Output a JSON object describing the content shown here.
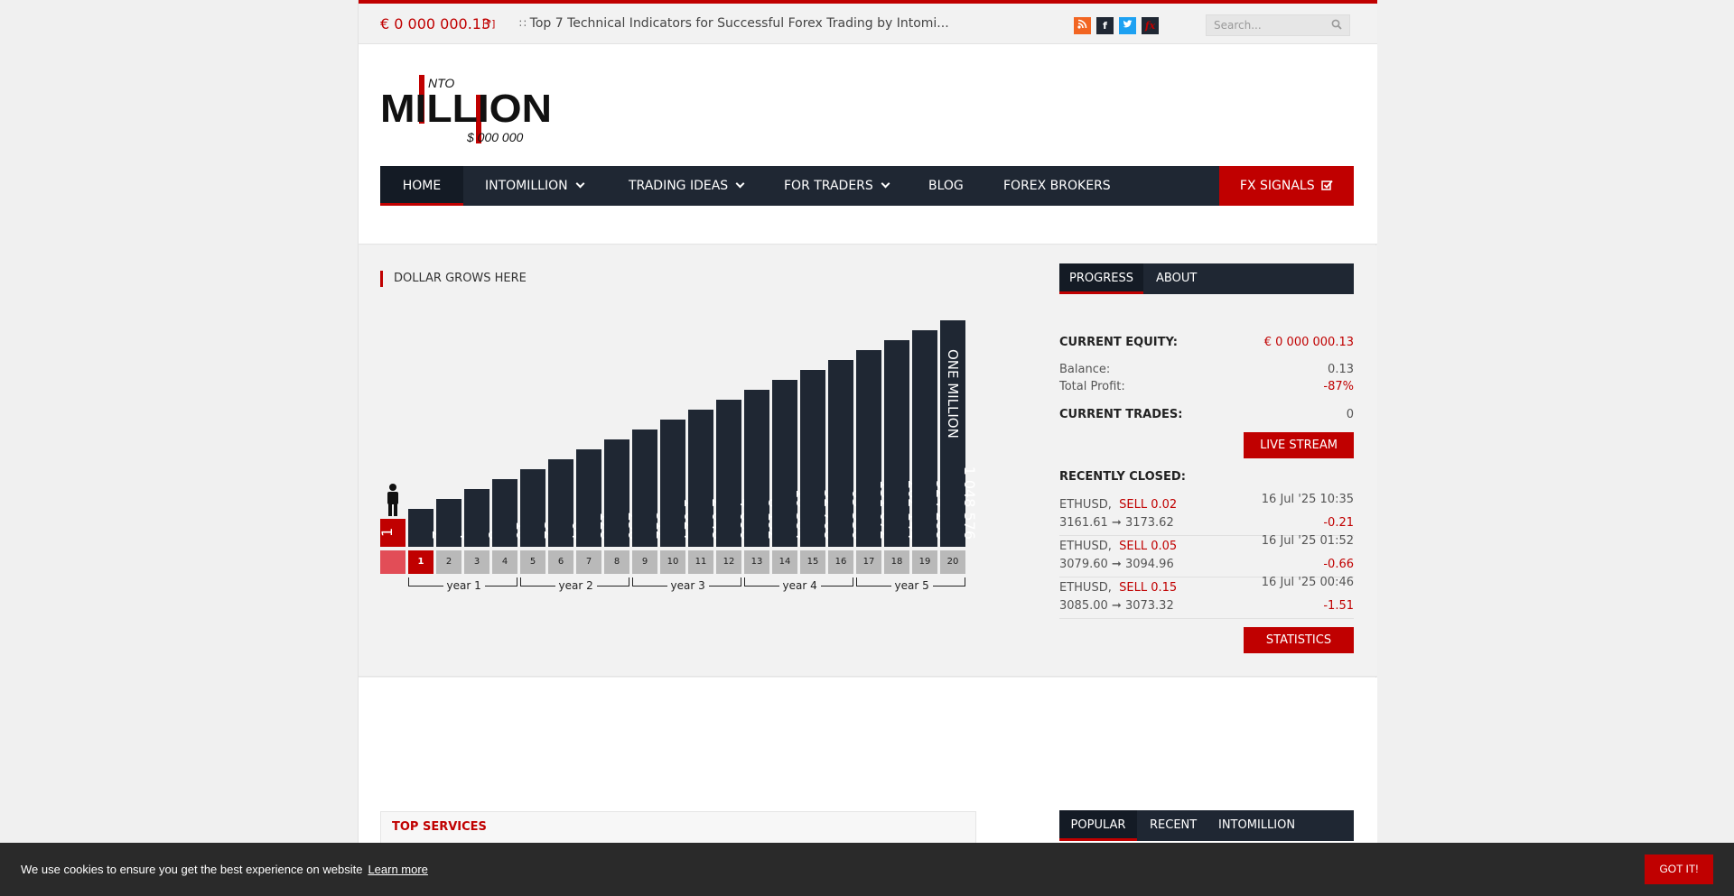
{
  "topbar": {
    "equity": "€ 0 000 000.13",
    "equity_help": "[?]",
    "news_text": "Top 7 Technical Indicators for Successful Forex Trading by Intomi...",
    "search_placeholder": "Search...",
    "social_icons": [
      "rss-icon",
      "facebook-icon",
      "twitter-icon",
      "fx-icon"
    ]
  },
  "logo": {
    "small_text": "NTO",
    "main_text": "MILLION",
    "sub_text": "$ 000 000"
  },
  "nav": {
    "items": [
      {
        "label": "HOME",
        "dropdown": false,
        "active": true
      },
      {
        "label": "INTOMILLION",
        "dropdown": true,
        "active": false
      },
      {
        "label": "TRADING IDEAS",
        "dropdown": true,
        "active": false
      },
      {
        "label": "FOR TRADERS",
        "dropdown": true,
        "active": false
      },
      {
        "label": "BLOG",
        "dropdown": false,
        "active": false
      },
      {
        "label": "FOREX BROKERS",
        "dropdown": false,
        "active": false
      }
    ],
    "signals_label": "FX SIGNALS"
  },
  "main": {
    "section_title": "DOLLAR GROWS HERE"
  },
  "chart_data": {
    "type": "bar",
    "categories": [
      "1",
      "2",
      "3",
      "4",
      "5",
      "6",
      "7",
      "8",
      "9",
      "10",
      "11",
      "12",
      "13",
      "14",
      "15",
      "16",
      "17",
      "18",
      "19",
      "20"
    ],
    "start_value": "1",
    "bar_labels": [
      "2",
      "4",
      "8",
      "16",
      "32",
      "64",
      "128",
      "256",
      "512",
      "1 024",
      "2 048",
      "4 096",
      "8 192",
      "16 384",
      "32 768",
      "65 536",
      "131 072",
      "262 144",
      "524 288",
      "1 048 576"
    ],
    "top_label": "ONE MILLION",
    "current_step": 1,
    "years": [
      "year 1",
      "year 2",
      "year 3",
      "year 4",
      "year 5"
    ]
  },
  "side": {
    "tabs": [
      "PROGRESS",
      "ABOUT"
    ],
    "current_equity_label": "CURRENT EQUITY:",
    "current_equity_value": "€ 0 000 000.13",
    "balance_label": "Balance:",
    "balance_value": "0.13",
    "profit_label": "Total Profit:",
    "profit_value": "-87%",
    "current_trades_label": "CURRENT TRADES:",
    "current_trades_value": "0",
    "live_stream_label": "LIVE STREAM",
    "recently_closed_label": "RECENTLY CLOSED:",
    "trades": [
      {
        "symbol": "ETHUSD,",
        "side": "SELL 0.02",
        "date": "16 Jul '25 10:35",
        "open": "3161.61",
        "close": "3173.62",
        "pl": "-0.21"
      },
      {
        "symbol": "ETHUSD,",
        "side": "SELL 0.05",
        "date": "16 Jul '25 01:52",
        "open": "3079.60",
        "close": "3094.96",
        "pl": "-0.66"
      },
      {
        "symbol": "ETHUSD,",
        "side": "SELL 0.15",
        "date": "16 Jul '25 00:46",
        "open": "3085.00",
        "close": "3073.32",
        "pl": "-1.51"
      }
    ],
    "statistics_label": "STATISTICS"
  },
  "lower": {
    "top_services_label": "TOP SERVICES",
    "tabs": [
      "POPULAR",
      "RECENT",
      "INTOMILLION"
    ]
  },
  "cookie": {
    "message": "We use cookies to ensure you get the best experience on website",
    "link": "Learn more",
    "button": "GOT IT!"
  },
  "colors": {
    "accent": "#c00000",
    "navy": "#1f2733",
    "grey_box": "#b9b9b9"
  }
}
